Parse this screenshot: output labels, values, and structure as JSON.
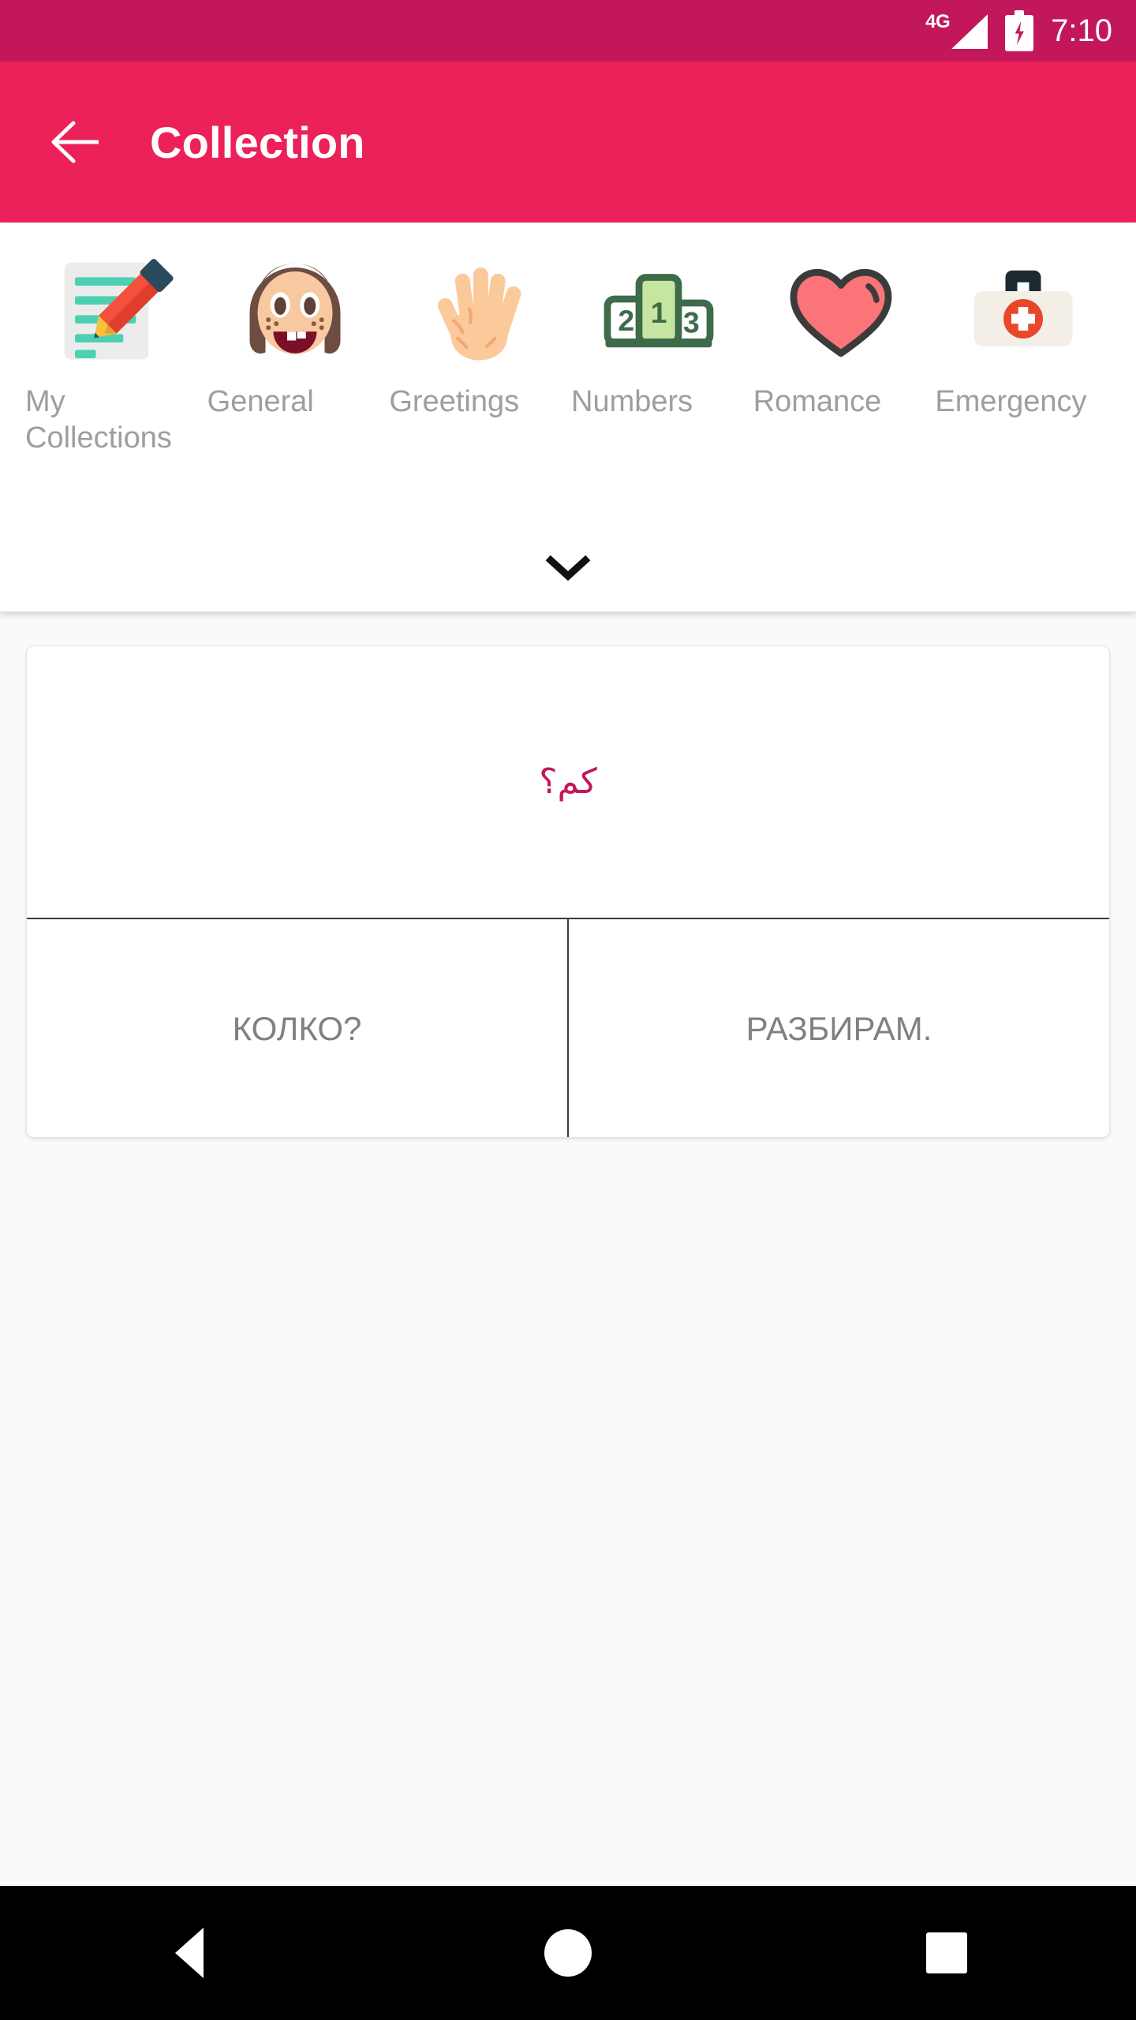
{
  "status_bar": {
    "network_label": "4G",
    "signal_icon": "signal-triangle-icon",
    "battery_icon": "battery-charging-icon",
    "time": "7:10",
    "background_color": "#C2185B"
  },
  "app_bar": {
    "back_icon": "arrow-back-icon",
    "title": "Collection",
    "background_color": "#EC2159",
    "title_color": "#FFFFFF"
  },
  "categories": {
    "expand_icon": "chevron-down-icon",
    "label_color": "#9E9E9E",
    "items": [
      {
        "label": "My Collections",
        "icon": "memo-pencil-icon"
      },
      {
        "label": "General",
        "icon": "girl-face-icon"
      },
      {
        "label": "Greetings",
        "icon": "raised-hand-icon"
      },
      {
        "label": "Numbers",
        "icon": "podium-123-icon"
      },
      {
        "label": "Romance",
        "icon": "heart-icon"
      },
      {
        "label": "Emergency",
        "icon": "first-aid-kit-icon"
      }
    ]
  },
  "phrase_card": {
    "source_text": "كم؟",
    "source_text_color": "#C2185B",
    "translation_left": "КОЛКО?",
    "translation_right": "РАЗБИРАМ.",
    "translation_color": "#808080"
  },
  "nav_bar": {
    "back_icon": "nav-back-triangle-icon",
    "home_icon": "nav-home-circle-icon",
    "recents_icon": "nav-recents-square-icon",
    "background_color": "#000000"
  }
}
